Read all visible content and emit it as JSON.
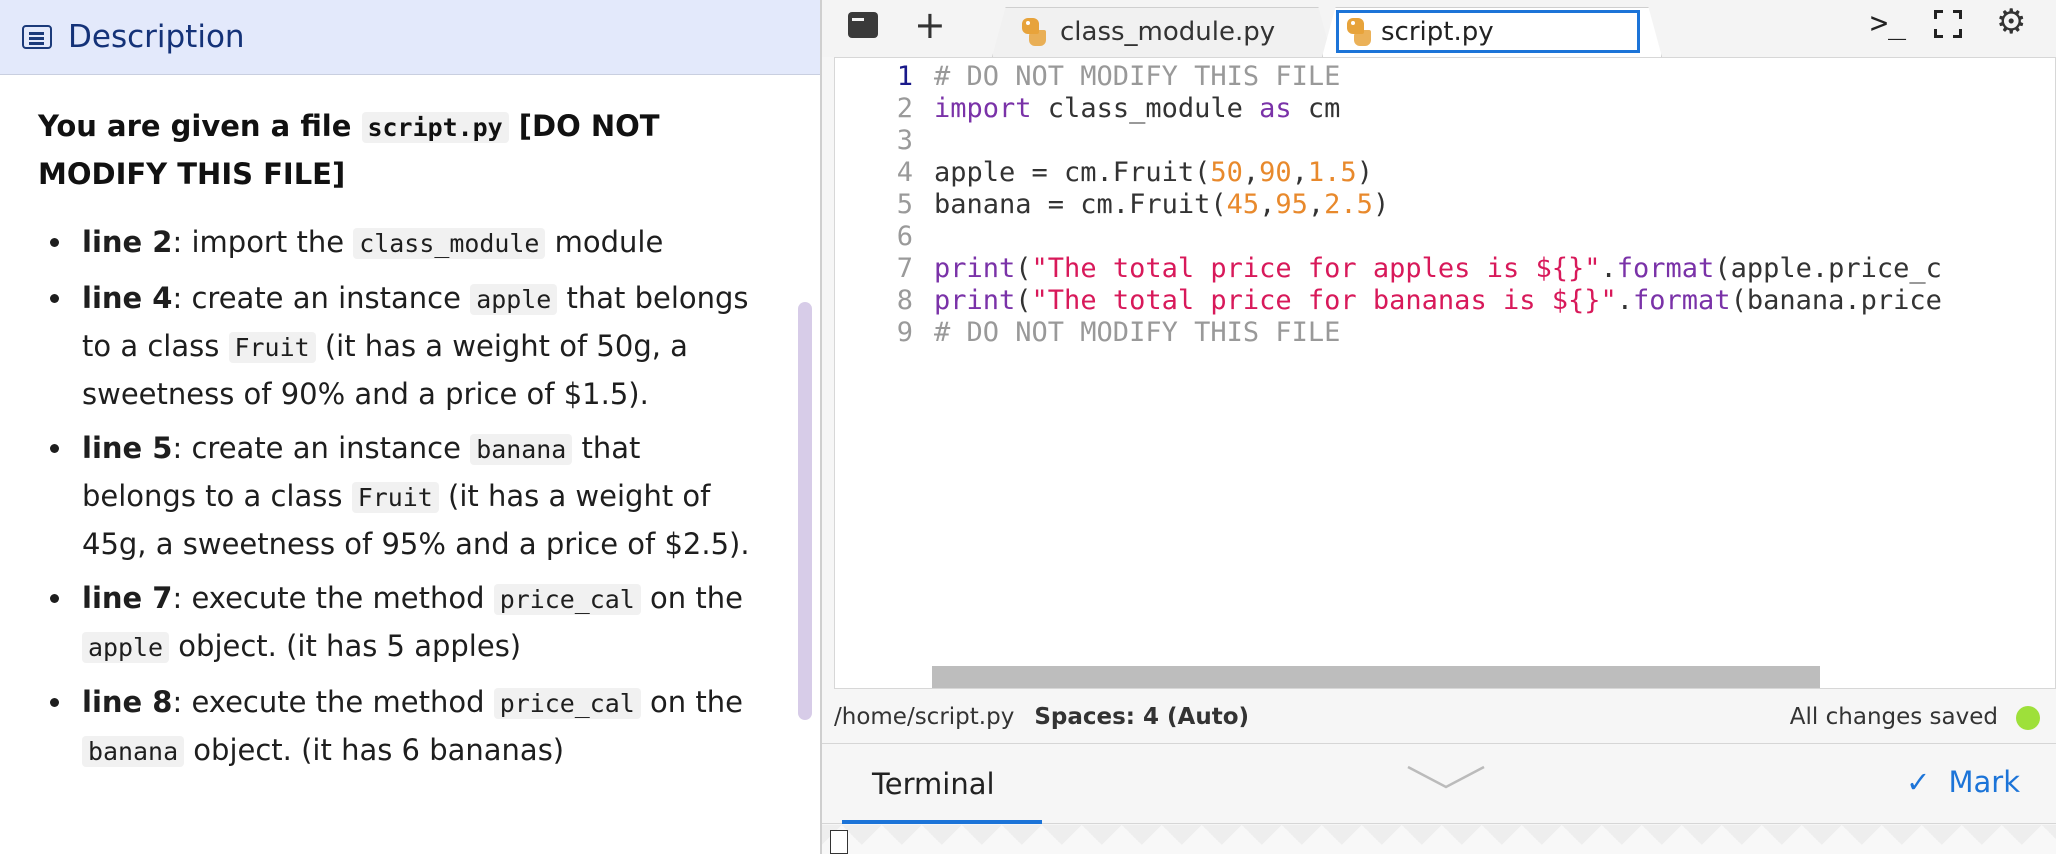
{
  "description_panel": {
    "title": "Description",
    "heading": {
      "prefix": "You are given a file ",
      "file": "script.py",
      "suffix": " [DO NOT MODIFY THIS FILE]"
    },
    "items": [
      {
        "line": "line 2",
        "parts": [
          ": import the ",
          "class_module",
          " module"
        ]
      },
      {
        "line": "line 4",
        "parts": [
          ": create an instance ",
          "apple",
          " that belongs to a class ",
          "Fruit",
          " (it has a weight of 50g, a sweetness of 90% and a price of $1.5)."
        ]
      },
      {
        "line": "line 5",
        "parts": [
          ": create an instance ",
          "banana",
          " that belongs to a class ",
          "Fruit",
          " (it has a weight of 45g, a sweetness of 95% and a price of $2.5)."
        ]
      },
      {
        "line": "line 7",
        "parts": [
          ": execute the method ",
          "price_cal",
          " on the ",
          "apple",
          " object. (it has 5 apples)"
        ]
      },
      {
        "line": "line 8",
        "parts": [
          ": execute the method ",
          "price_cal",
          " on the ",
          "banana",
          " object. (it has 6 bananas)"
        ]
      }
    ]
  },
  "tabs": [
    {
      "label": "class_module.py",
      "icon": "python-icon"
    },
    {
      "label": "script.py",
      "icon": "python-icon",
      "active": true
    }
  ],
  "toolbar": {
    "new_tab": "+",
    "console": ">_",
    "settings": "⚙"
  },
  "editor": {
    "line_numbers": [
      "1",
      "2",
      "3",
      "4",
      "5",
      "6",
      "7",
      "8",
      "9"
    ],
    "active_line": "1",
    "lines": [
      [
        {
          "t": "# DO NOT MODIFY THIS FILE",
          "c": "cmt"
        }
      ],
      [
        {
          "t": "import",
          "c": "kw"
        },
        {
          "t": " class_module ",
          "c": ""
        },
        {
          "t": "as",
          "c": "kw"
        },
        {
          "t": " cm",
          "c": ""
        }
      ],
      [],
      [
        {
          "t": "apple = cm.Fruit(",
          "c": ""
        },
        {
          "t": "50",
          "c": "num"
        },
        {
          "t": ",",
          "c": ""
        },
        {
          "t": "90",
          "c": "num"
        },
        {
          "t": ",",
          "c": ""
        },
        {
          "t": "1.5",
          "c": "num"
        },
        {
          "t": ")",
          "c": ""
        }
      ],
      [
        {
          "t": "banana = cm.Fruit(",
          "c": ""
        },
        {
          "t": "45",
          "c": "num"
        },
        {
          "t": ",",
          "c": ""
        },
        {
          "t": "95",
          "c": "num"
        },
        {
          "t": ",",
          "c": ""
        },
        {
          "t": "2.5",
          "c": "num"
        },
        {
          "t": ")",
          "c": ""
        }
      ],
      [],
      [
        {
          "t": "print",
          "c": "kw"
        },
        {
          "t": "(",
          "c": ""
        },
        {
          "t": "\"The total price for apples is ${}\"",
          "c": "str"
        },
        {
          "t": ".",
          "c": ""
        },
        {
          "t": "format",
          "c": "kw"
        },
        {
          "t": "(apple.price_c",
          "c": ""
        }
      ],
      [
        {
          "t": "print",
          "c": "kw"
        },
        {
          "t": "(",
          "c": ""
        },
        {
          "t": "\"The total price for bananas is ${}\"",
          "c": "str"
        },
        {
          "t": ".",
          "c": ""
        },
        {
          "t": "format",
          "c": "kw"
        },
        {
          "t": "(banana.price",
          "c": ""
        }
      ],
      [
        {
          "t": "# DO NOT MODIFY THIS FILE",
          "c": "cmt"
        }
      ]
    ]
  },
  "status_bar": {
    "path": "/home/script.py",
    "spaces": "Spaces: 4 (Auto)",
    "saved": "All changes saved",
    "saved_color": "#9ee03a"
  },
  "terminal": {
    "tab_label": "Terminal",
    "mark_label": "Mark",
    "mark_icon": "✓"
  },
  "colors": {
    "accent": "#1c74d8",
    "keyword": "#7a32a8",
    "number": "#e8892c",
    "string": "#d8195a"
  }
}
